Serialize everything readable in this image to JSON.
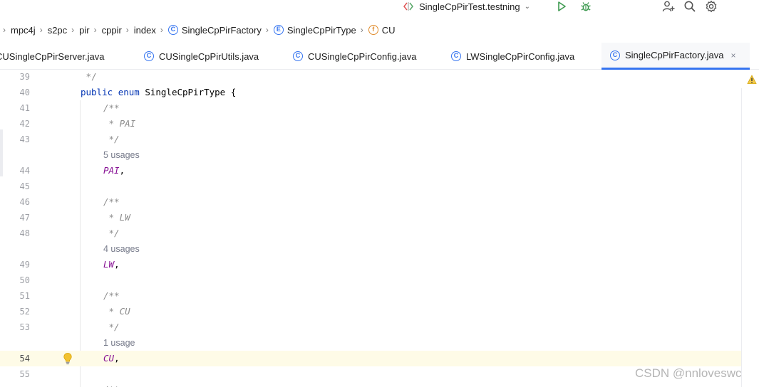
{
  "toolbar": {
    "run_config": "SingleCpPirTest.testning",
    "icons": [
      "testng-config-icon",
      "chevron-down-icon",
      "run-icon",
      "debug-icon",
      "add-user-icon",
      "search-icon",
      "gear-icon"
    ]
  },
  "breadcrumb": {
    "items": [
      "mpc4j",
      "s2pc",
      "pir",
      "cppir",
      "index",
      "SingleCpPirFactory",
      "SingleCpPirType",
      "CU"
    ],
    "icon_letters": {
      "class": "C",
      "enum": "E",
      "field": "f"
    }
  },
  "tabs": [
    {
      "label": "CUSingleCpPirServer.java",
      "visible": "CUSingleCpPirServer.java"
    },
    {
      "label": "CUSingleCpPirUtils.java"
    },
    {
      "label": "CUSingleCpPirConfig.java"
    },
    {
      "label": "LWSingleCpPirConfig.java"
    },
    {
      "label": "SingleCpPirFactory.java",
      "active": true,
      "close": "×"
    }
  ],
  "editor": {
    "lines": {
      "l39": {
        "num": "39",
        "text": " */"
      },
      "l40": {
        "num": "40",
        "kw1": "public",
        "kw2": "enum",
        "rest": " SingleCpPirType {"
      },
      "l41": {
        "num": "41",
        "text": "/**"
      },
      "l42": {
        "num": "42",
        "text": " * PAI"
      },
      "l43": {
        "num": "43",
        "text": " */"
      },
      "u1": {
        "text": "5 usages"
      },
      "l44": {
        "num": "44",
        "const": "PAI",
        "punct": ","
      },
      "l45": {
        "num": "45"
      },
      "l46": {
        "num": "46",
        "text": "/**"
      },
      "l47": {
        "num": "47",
        "text": " * LW"
      },
      "l48": {
        "num": "48",
        "text": " */"
      },
      "u2": {
        "text": "4 usages"
      },
      "l49": {
        "num": "49",
        "const": "LW",
        "punct": ","
      },
      "l50": {
        "num": "50"
      },
      "l51": {
        "num": "51",
        "text": "/**"
      },
      "l52": {
        "num": "52",
        "text": " * CU"
      },
      "l53": {
        "num": "53",
        "text": " */"
      },
      "u3": {
        "text": "1 usage"
      },
      "l54": {
        "num": "54",
        "const": "CU",
        "punct": ","
      },
      "l55": {
        "num": "55"
      },
      "l56": {
        "text": "/**"
      }
    }
  },
  "watermark": "CSDN @nnloveswc",
  "colors": {
    "accent": "#3574f0",
    "keyword": "#0033b3",
    "enum_constant": "#871094",
    "comment": "#8c8c8c",
    "current_line": "#fefbe7"
  }
}
